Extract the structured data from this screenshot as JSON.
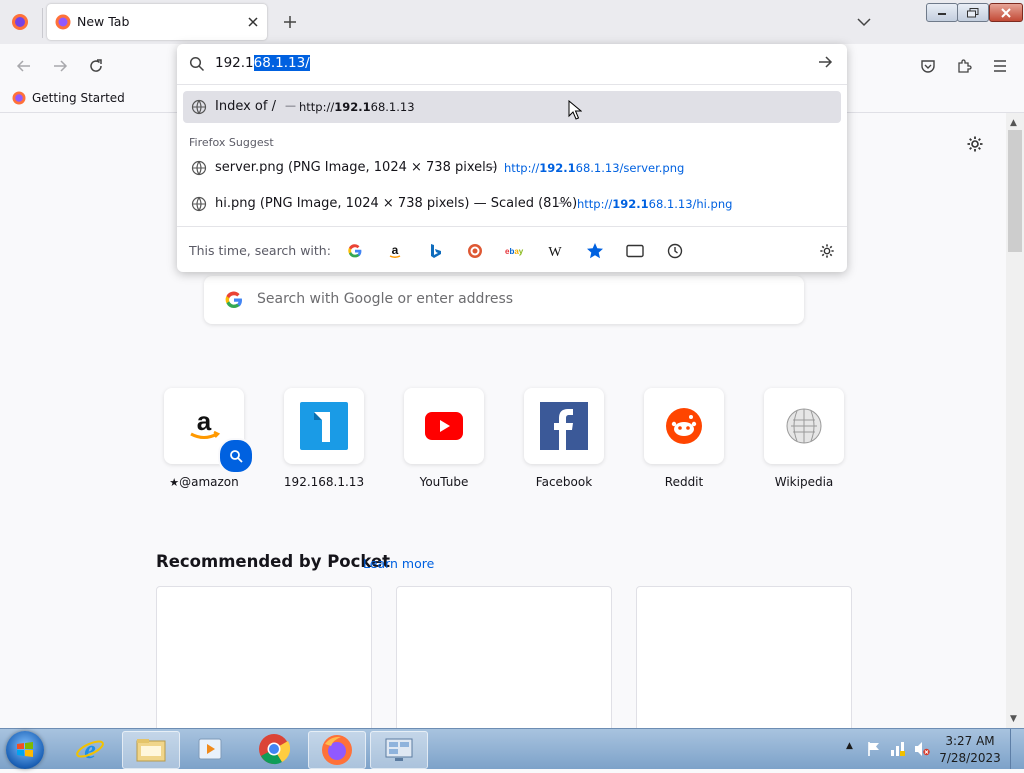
{
  "tabs": [
    {
      "title": "New Tab",
      "active": true
    }
  ],
  "urlbar": {
    "typed_text": "192.1",
    "autofill_text": "68.1.13/",
    "results": [
      {
        "title": "Index of /",
        "separator": "—",
        "url_prefix": "http://",
        "url_match": "192.1",
        "url_rest": "68.1.13",
        "highlighted": true
      },
      {
        "title": "server.png (PNG Image, 1024 × 738 pixels)",
        "separator": "—",
        "url_prefix": "http://",
        "url_match": "192.1",
        "url_rest": "68.1.13/server.png"
      },
      {
        "title": "hi.png (PNG Image, 1024 × 738 pixels) — Scaled (81%)",
        "separator": "—",
        "url_prefix": "http://",
        "url_match": "192.1",
        "url_rest": "68.1.13/hi.png"
      }
    ],
    "suggest_group_label": "Firefox Suggest",
    "oneoff_label": "This time, search with:",
    "oneoff_engines": [
      "google-icon",
      "amazon-icon",
      "bing-icon",
      "duckduckgo-icon",
      "ebay-icon",
      "wikipedia-icon",
      "bookmarks-icon",
      "tabs-icon",
      "history-icon"
    ]
  },
  "bookmarks": [
    {
      "label": "Getting Started"
    }
  ],
  "newtab": {
    "search_placeholder": "Search with Google or enter address",
    "top_sites": [
      {
        "label": "@amazon",
        "icon": "amazon-icon",
        "pinned": true
      },
      {
        "label": "192.168.1.13",
        "icon": "site-1-icon"
      },
      {
        "label": "YouTube",
        "icon": "youtube-icon"
      },
      {
        "label": "Facebook",
        "icon": "facebook-icon"
      },
      {
        "label": "Reddit",
        "icon": "reddit-icon"
      },
      {
        "label": "Wikipedia",
        "icon": "wikipedia-icon"
      }
    ],
    "pocket_heading": "Recommended by Pocket",
    "pocket_learn_more": "Learn more"
  },
  "taskbar": {
    "time": "3:27 AM",
    "date": "7/28/2023"
  },
  "colors": {
    "accent": "#0061e0",
    "selection": "#0061e0"
  }
}
